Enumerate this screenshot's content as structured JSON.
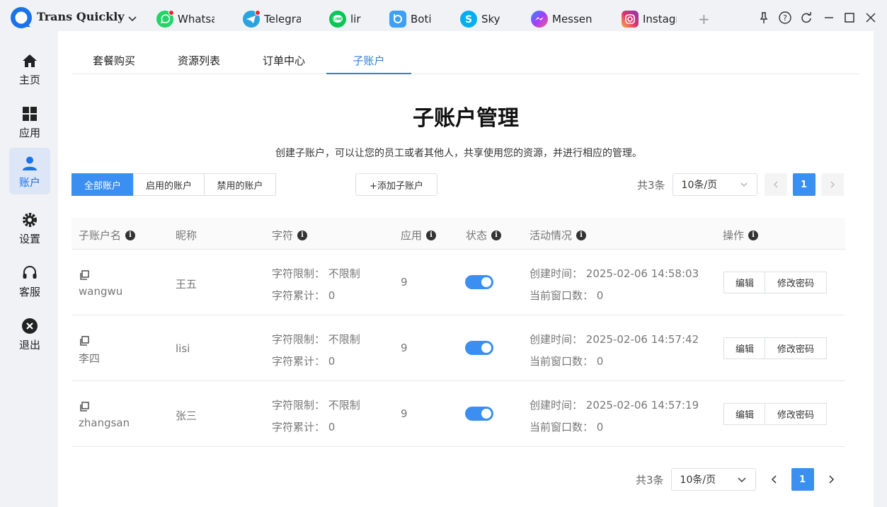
{
  "app": {
    "brand": "Trans Quickly"
  },
  "app_tabs": [
    {
      "label": "Whatsa",
      "icon": "whatsapp-icon",
      "color": "#25d366",
      "notif": true
    },
    {
      "label": "Telegra",
      "icon": "telegram-icon",
      "color": "#2aa3e0",
      "notif": true
    },
    {
      "label": "lir",
      "icon": "line-icon",
      "color": "#06c755",
      "notif": false
    },
    {
      "label": "Boti",
      "icon": "botim-icon",
      "color": "#3da0f5",
      "notif": false
    },
    {
      "label": "Sky",
      "icon": "skype-icon",
      "color": "#00aff0",
      "notif": false
    },
    {
      "label": "Messen",
      "icon": "messenger-icon",
      "color": "#7a5cf7",
      "notif": false
    },
    {
      "label": "Instagr",
      "icon": "instagram-icon",
      "color": "#e1306c",
      "notif": false
    }
  ],
  "add_tab_label": "+",
  "sidebar": {
    "items": [
      {
        "label": "主页",
        "icon": "home-icon"
      },
      {
        "label": "应用",
        "icon": "apps-grid-icon"
      },
      {
        "label": "账户",
        "icon": "user-icon"
      },
      {
        "label": "设置",
        "icon": "gear-icon"
      },
      {
        "label": "客服",
        "icon": "headset-icon"
      },
      {
        "label": "退出",
        "icon": "close-circle-icon"
      }
    ]
  },
  "tabs": [
    "套餐购买",
    "资源列表",
    "订单中心",
    "子账户"
  ],
  "header": {
    "title": "子账户管理",
    "subtitle": "创建子账户，可以让您的员工或者其他人，共享使用您的资源，并进行相应的管理。"
  },
  "filters": [
    "全部账户",
    "启用的账户",
    "禁用的账户"
  ],
  "add_button": "+添加子账户",
  "pagination": {
    "total": "共3条",
    "page_size": "10条/页",
    "current_page": "1"
  },
  "table": {
    "columns": [
      "子账户名",
      "昵称",
      "字符",
      "应用",
      "状态",
      "活动情况",
      "操作"
    ],
    "char_limit_label": "字符限制：",
    "char_total_label": "字符累计：",
    "created_label": "创建时间：",
    "windows_label": "当前窗口数：",
    "edit_label": "编辑",
    "change_pwd_label": "修改密码",
    "rows": [
      {
        "username": "wangwu",
        "nickname": "王五",
        "char_limit": "不限制",
        "char_total": "0",
        "apps": "9",
        "enabled": true,
        "created": "2025-02-06 14:58:03",
        "windows": "0"
      },
      {
        "username": "李四",
        "nickname": "lisi",
        "char_limit": "不限制",
        "char_total": "0",
        "apps": "9",
        "enabled": true,
        "created": "2025-02-06 14:57:42",
        "windows": "0"
      },
      {
        "username": "zhangsan",
        "nickname": "张三",
        "char_limit": "不限制",
        "char_total": "0",
        "apps": "9",
        "enabled": true,
        "created": "2025-02-06 14:57:19",
        "windows": "0"
      }
    ]
  },
  "colors": {
    "accent": "#3b8ff0",
    "tab_active": "#2f7fda"
  }
}
